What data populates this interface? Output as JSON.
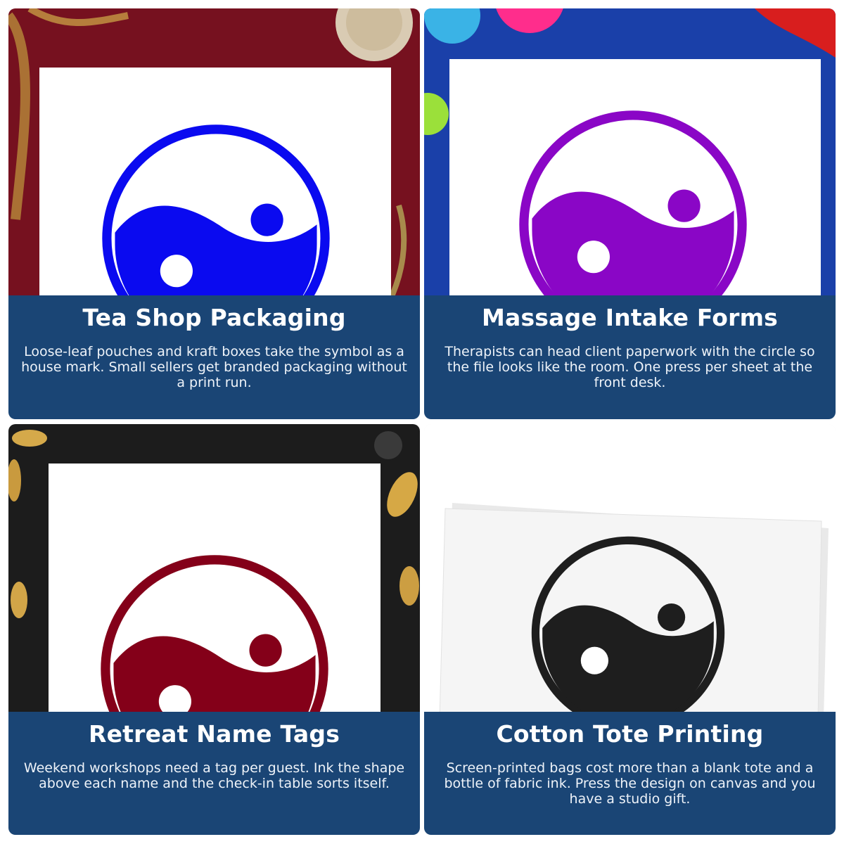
{
  "cards": [
    {
      "title": "Tea Shop Packaging",
      "description": "Loose-leaf pouches and kraft boxes take the symbol as a house mark. Small sellers get branded packaging without a print run.",
      "symbol_color": "#0a0af0",
      "background": "dark red fabric"
    },
    {
      "title": "Massage Intake Forms",
      "description": "Therapists can head client paperwork with the circle so the file looks like the room. One press per sheet at the front desk.",
      "symbol_color": "#8a06c6",
      "background": "blue fabric"
    },
    {
      "title": "Retreat Name Tags",
      "description": "Weekend workshops need a tag per guest. Ink the shape above each name and the check-in table sorts itself.",
      "symbol_color": "#840019",
      "background": "black with gold leaves"
    },
    {
      "title": "Cotton Tote Printing",
      "description": "Screen-printed bags cost more than a blank tote and a bottle of fabric ink. Press the design on canvas and you have a studio gift.",
      "symbol_color": "#1e1e1e",
      "background": "white"
    }
  ],
  "icons": {
    "symbol": "yin-yang-icon"
  }
}
